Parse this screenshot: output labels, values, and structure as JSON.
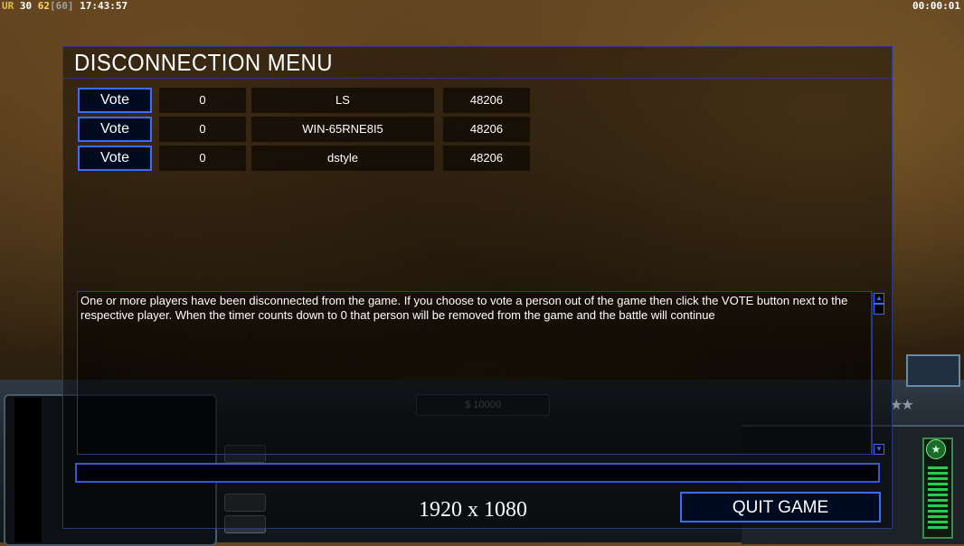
{
  "hud": {
    "ur_label": "UR",
    "ur_value": "30",
    "fps": "62",
    "fps_cap": "[60]",
    "clock": "17:43:57",
    "game_timer": "00:00:01"
  },
  "game_ui": {
    "money": "$ 10000"
  },
  "dialog": {
    "title": "DISCONNECTION MENU",
    "players": [
      {
        "vote_label": "Vote",
        "votes": "0",
        "name": "LS",
        "port": "48206"
      },
      {
        "vote_label": "Vote",
        "votes": "0",
        "name": "WIN-65RNE8I5",
        "port": "48206"
      },
      {
        "vote_label": "Vote",
        "votes": "0",
        "name": "dstyle",
        "port": "48206"
      }
    ],
    "message": "One or more players have been disconnected from the game. If you choose to vote a person out of the game then click the VOTE button next to the respective player. When the timer counts down to 0 that person will be removed from the game and the battle will continue",
    "chat_value": "",
    "quit_label": "QUIT GAME"
  },
  "overlay": {
    "resolution": "1920 x 1080"
  },
  "colors": {
    "accent_blue": "#3c6cff",
    "frame_blue": "#2a3a80"
  }
}
